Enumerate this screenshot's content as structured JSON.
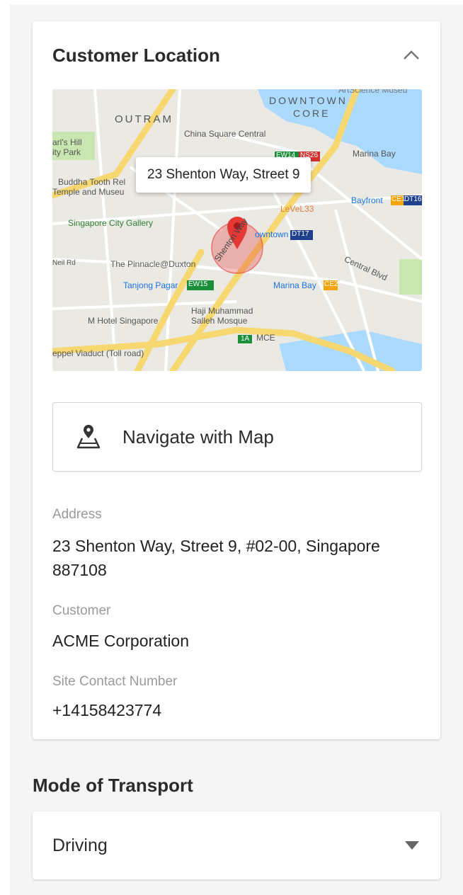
{
  "location_card": {
    "title": "Customer Location",
    "chevron_icon": "chevron-up-icon",
    "map": {
      "tooltip": "23 Shenton Way, Street 9",
      "pin_icon": "map-pin-icon",
      "labels": {
        "downtown_core_1": "DOWNTOWN",
        "downtown_core_2": "CORE",
        "outram": "OUTRAM",
        "china_square": "China Square Central",
        "pearls_hill_1": "arl's Hill",
        "pearls_hill_2": "ity Park",
        "marina_bay_top": "Marina Bay",
        "buddha_1": "Buddha Tooth Rel",
        "buddha_2": "Temple and Museu",
        "level33": "LeVeL33",
        "bayfront": "Bayfront",
        "city_gallery": "Singapore City Gallery",
        "downtown_station": "owntown",
        "pinnacle": "The Pinnacle@Duxton",
        "tanjong_pagar": "Tanjong Pagar",
        "marina_bay_station": "Marina Bay",
        "shenton_way": "Shenton Way",
        "central_blvd": "Central Blvd",
        "haji_1": "Haji Muhammad",
        "haji_2": "Salleh Mosque",
        "m_hotel": "M Hotel Singapore",
        "mce": "MCE",
        "viaduct": "eppel Viaduct (Toll road)",
        "artscience": "ArtScience Museu",
        "neil_rd": "Neil Rd",
        "ew15": "EW15",
        "ew14": "EW14",
        "ns26": "NS26",
        "dt17": "DT17",
        "ce1": "CE1",
        "dt16": "DT16",
        "ce2": "CE2",
        "route_1a": "1A"
      }
    },
    "navigate_button": {
      "label": "Navigate with Map",
      "icon": "map-location-icon"
    },
    "fields": {
      "address_label": "Address",
      "address_value": "23 Shenton Way, Street 9, #02-00, Singapore 887108",
      "customer_label": "Customer",
      "customer_value": "ACME Corporation",
      "contact_label": "Site Contact Number",
      "contact_value": "+14158423774"
    }
  },
  "transport": {
    "title": "Mode of Transport",
    "selected": "Driving",
    "caret_icon": "caret-down-icon"
  },
  "colors": {
    "map_water": "#aadaff",
    "map_road_major": "#f6d770",
    "pin": "#e53935"
  }
}
